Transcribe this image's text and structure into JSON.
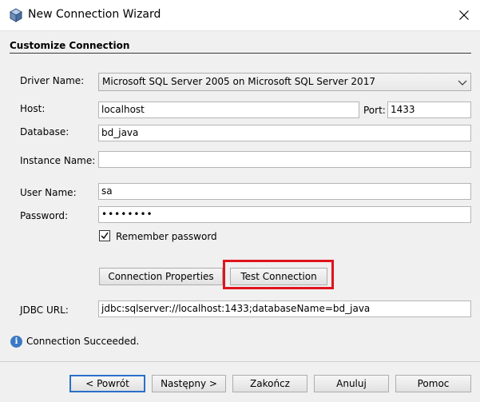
{
  "window": {
    "title": "New Connection Wizard"
  },
  "section": {
    "title": "Customize Connection"
  },
  "form": {
    "driver_label": "Driver Name:",
    "driver_value": "Microsoft SQL Server 2005 on Microsoft SQL Server 2017",
    "host_label": "Host:",
    "host_value": "localhost",
    "port_label": "Port:",
    "port_value": "1433",
    "database_label": "Database:",
    "database_value": "bd_java",
    "instance_label": "Instance Name:",
    "instance_value": "",
    "user_label": "User Name:",
    "user_value": "sa",
    "password_label": "Password:",
    "password_value": "••••••••",
    "remember_label": "Remember password",
    "remember_checked": true,
    "jdbc_label": "JDBC URL:",
    "jdbc_value": "jdbc:sqlserver://localhost:1433;databaseName=bd_java"
  },
  "actions": {
    "connection_properties": "Connection Properties",
    "test_connection": "Test Connection"
  },
  "status": {
    "message": "Connection Succeeded."
  },
  "footer": {
    "back": "< Powrót",
    "next": "Następny >",
    "finish": "Zakończ",
    "cancel": "Anuluj",
    "help": "Pomoc"
  },
  "colors": {
    "highlight": "#e0131c",
    "default_button_border": "#2a6fc9",
    "info_icon": "#3c79c4"
  },
  "icons": {
    "app": "cube-icon",
    "close": "close-icon",
    "combo": "chevron-down-icon",
    "info": "info-icon",
    "check": "checkmark-icon"
  }
}
